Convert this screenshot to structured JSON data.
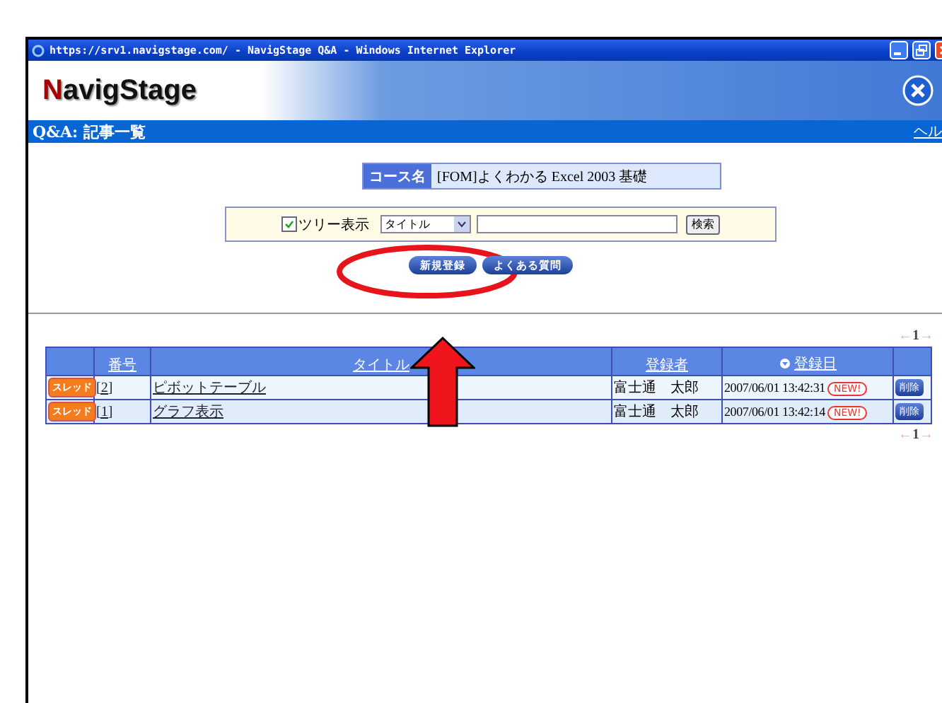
{
  "browser": {
    "title": "https://srv1.navigstage.com/ - NavigStage Q&A - Windows Internet Explorer"
  },
  "header": {
    "logo_initial": "N",
    "logo_rest": "avigStage"
  },
  "page_bar": {
    "title": "Q&A: 記事一覧",
    "help": "ヘル"
  },
  "course": {
    "label": "コース名",
    "value": "[FOM]よくわかる Excel 2003 基礎"
  },
  "search": {
    "tree_view": {
      "label": "ツリー表示",
      "checked": true
    },
    "field_select": "タイトル",
    "button": "検索"
  },
  "actions": [
    "新規登録",
    "よくある質問"
  ],
  "pagination_top": {
    "prev": "←",
    "page": "1",
    "next": "→"
  },
  "table": {
    "columns": [
      {
        "label": "番号",
        "sorted": false
      },
      {
        "label": "タイトル",
        "sorted": false
      },
      {
        "label": "登録者",
        "sorted": false
      },
      {
        "label": "登録日",
        "sorted": true
      }
    ],
    "rows": [
      {
        "badge": "スレッド",
        "number": "[2]",
        "title": "ピボットテーブル",
        "author": "富士通　太郎",
        "date": "2007/06/01 13:42:31",
        "new": "NEW!",
        "delete": "削除"
      },
      {
        "badge": "スレッド",
        "number": "[1]",
        "title": "グラフ表示",
        "author": "富士通　太郎",
        "date": "2007/06/01 13:42:14",
        "new": "NEW!",
        "delete": "削除"
      }
    ]
  },
  "pagination_bottom": {
    "prev": "←",
    "page": "1",
    "next": "→"
  },
  "annotations": [
    {
      "kind": "ellipse"
    },
    {
      "kind": "arrow"
    }
  ]
}
